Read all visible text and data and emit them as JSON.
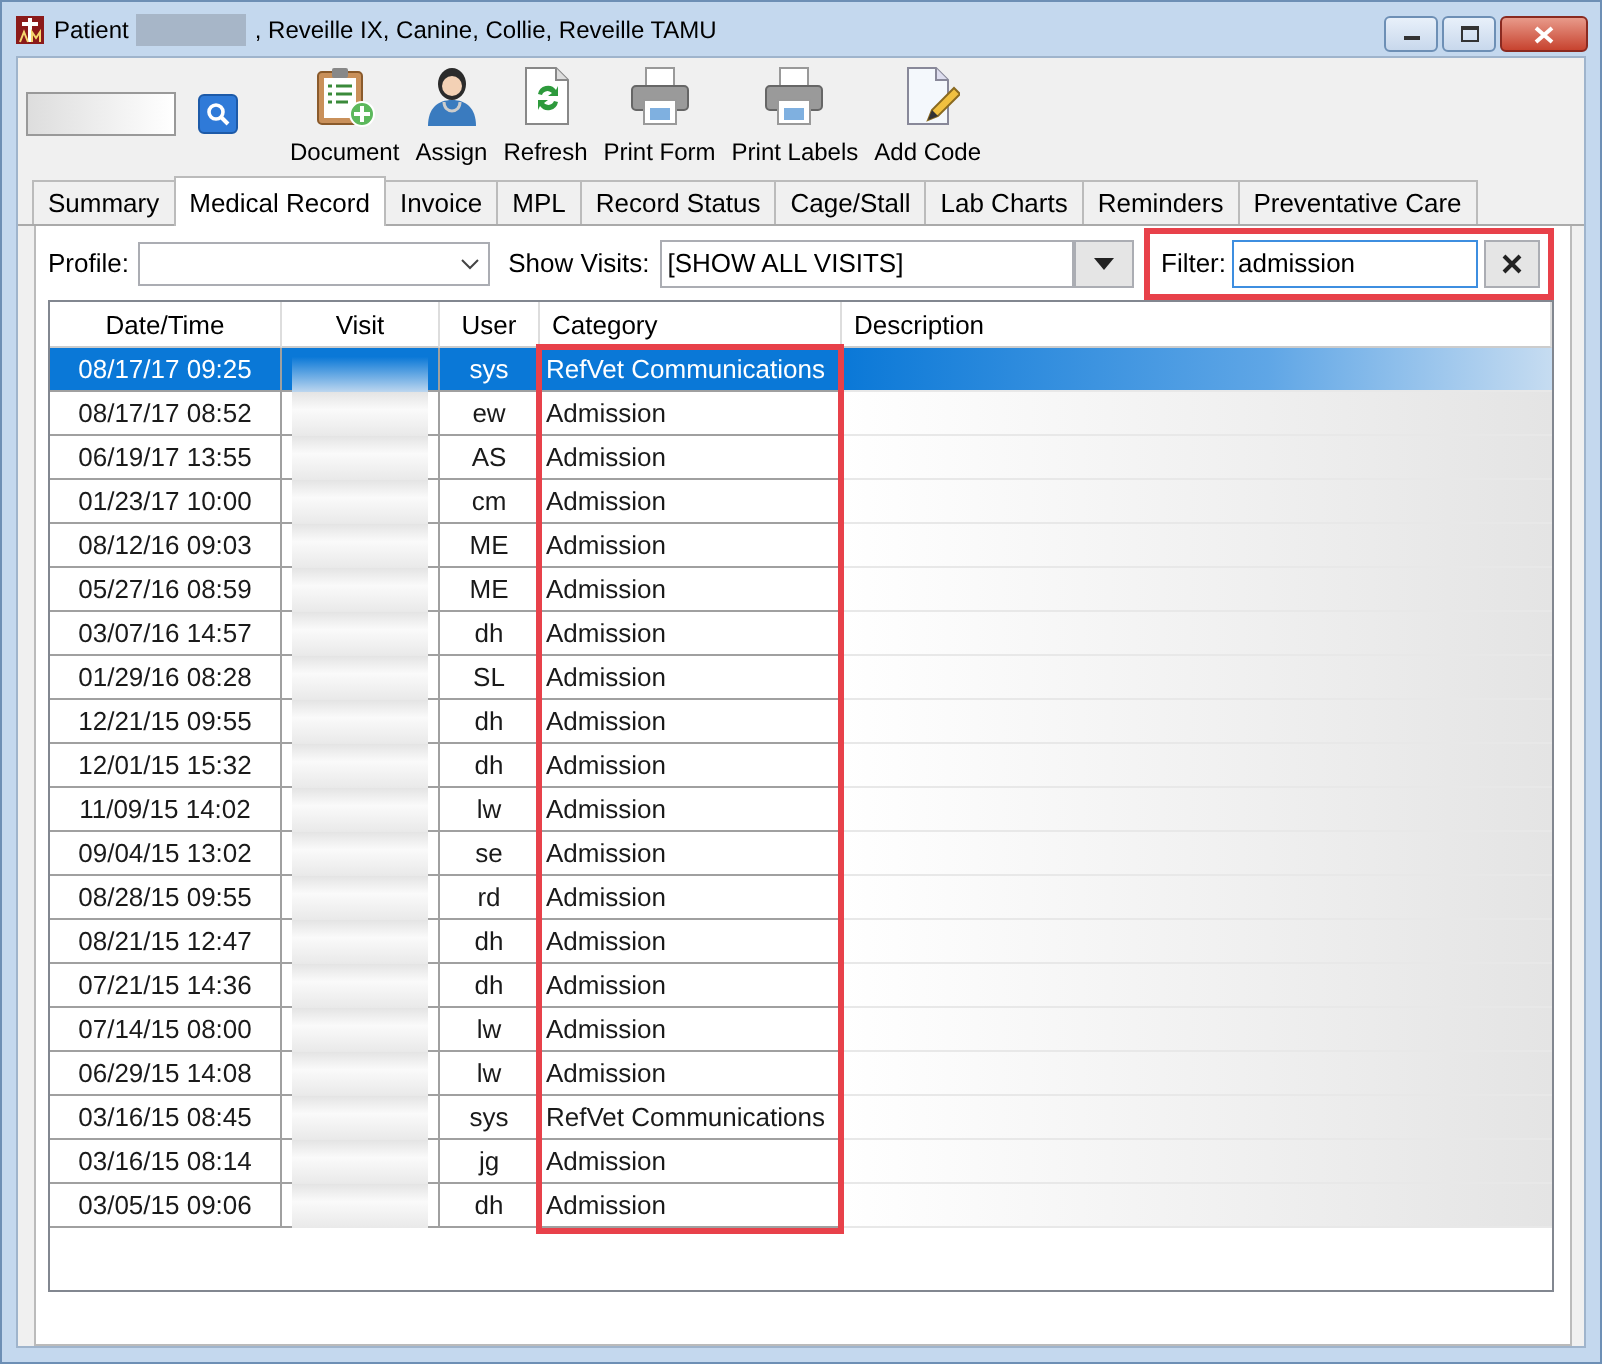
{
  "window": {
    "title_prefix": "Patient",
    "title_rest": ", Reveille IX, Canine, Collie, Reveille TAMU"
  },
  "toolbar": {
    "buttons": [
      {
        "label": "Document",
        "kind": "clipboard"
      },
      {
        "label": "Assign",
        "kind": "person"
      },
      {
        "label": "Refresh",
        "kind": "refresh"
      },
      {
        "label": "Print Form",
        "kind": "printer"
      },
      {
        "label": "Print Labels",
        "kind": "printer"
      },
      {
        "label": "Add Code",
        "kind": "pencil"
      }
    ]
  },
  "tabs": [
    {
      "label": "Summary",
      "selected": false
    },
    {
      "label": "Medical Record",
      "selected": true
    },
    {
      "label": "Invoice",
      "selected": false
    },
    {
      "label": "MPL",
      "selected": false
    },
    {
      "label": "Record Status",
      "selected": false
    },
    {
      "label": "Cage/Stall",
      "selected": false
    },
    {
      "label": "Lab Charts",
      "selected": false
    },
    {
      "label": "Reminders",
      "selected": false
    },
    {
      "label": "Preventative Care",
      "selected": false
    }
  ],
  "filter_bar": {
    "profile_label": "Profile:",
    "show_visits_label": "Show Visits:",
    "show_visits_value": "[SHOW ALL VISITS]",
    "filter_label": "Filter:",
    "filter_value": "admission",
    "filter_highlighted": true
  },
  "table": {
    "columns": [
      {
        "label": "Date/Time",
        "highlighted": false
      },
      {
        "label": "Visit",
        "highlighted": false
      },
      {
        "label": "User",
        "highlighted": false
      },
      {
        "label": "Category",
        "highlighted": true
      },
      {
        "label": "Description",
        "highlighted": false
      }
    ],
    "rows": [
      {
        "date_time": "08/17/17 09:25",
        "user": "sys",
        "category": "RefVet Communications",
        "selected": true
      },
      {
        "date_time": "08/17/17 08:52",
        "user": "ew",
        "category": "Admission",
        "selected": false
      },
      {
        "date_time": "06/19/17 13:55",
        "user": "AS",
        "category": "Admission",
        "selected": false
      },
      {
        "date_time": "01/23/17 10:00",
        "user": "cm",
        "category": "Admission",
        "selected": false
      },
      {
        "date_time": "08/12/16 09:03",
        "user": "ME",
        "category": "Admission",
        "selected": false
      },
      {
        "date_time": "05/27/16 08:59",
        "user": "ME",
        "category": "Admission",
        "selected": false
      },
      {
        "date_time": "03/07/16 14:57",
        "user": "dh",
        "category": "Admission",
        "selected": false
      },
      {
        "date_time": "01/29/16 08:28",
        "user": "SL",
        "category": "Admission",
        "selected": false
      },
      {
        "date_time": "12/21/15 09:55",
        "user": "dh",
        "category": "Admission",
        "selected": false
      },
      {
        "date_time": "12/01/15 15:32",
        "user": "dh",
        "category": "Admission",
        "selected": false
      },
      {
        "date_time": "11/09/15 14:02",
        "user": "lw",
        "category": "Admission",
        "selected": false
      },
      {
        "date_time": "09/04/15 13:02",
        "user": "se",
        "category": "Admission",
        "selected": false
      },
      {
        "date_time": "08/28/15 09:55",
        "user": "rd",
        "category": "Admission",
        "selected": false
      },
      {
        "date_time": "08/21/15 12:47",
        "user": "dh",
        "category": "Admission",
        "selected": false
      },
      {
        "date_time": "07/21/15 14:36",
        "user": "dh",
        "category": "Admission",
        "selected": false
      },
      {
        "date_time": "07/14/15 08:00",
        "user": "lw",
        "category": "Admission",
        "selected": false
      },
      {
        "date_time": "06/29/15 14:08",
        "user": "lw",
        "category": "Admission",
        "selected": false
      },
      {
        "date_time": "03/16/15 08:45",
        "user": "sys",
        "category": "RefVet Communications",
        "selected": false
      },
      {
        "date_time": "03/16/15 08:14",
        "user": "jg",
        "category": "Admission",
        "selected": false
      },
      {
        "date_time": "03/05/15 09:06",
        "user": "dh",
        "category": "Admission",
        "selected": false
      }
    ]
  }
}
